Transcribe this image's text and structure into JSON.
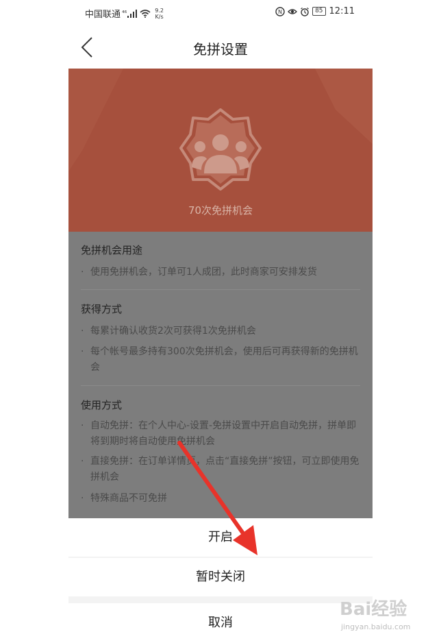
{
  "status_bar": {
    "carrier": "中国联通",
    "network_badge": "⁴⁶",
    "net_speed_value": "9.2",
    "net_speed_unit": "K/s",
    "battery": "85",
    "time": "12:11"
  },
  "nav": {
    "title": "免拼设置"
  },
  "hero": {
    "text": "70次免拼机会"
  },
  "sections": [
    {
      "title": "免拼机会用途",
      "items": [
        "使用免拼机会，订单可1人成团，此时商家可安排发货"
      ]
    },
    {
      "title": "获得方式",
      "items": [
        "每累计确认收货2次可获得1次免拼机会",
        "每个帐号最多持有300次免拼机会，使用后可再获得新的免拼机会"
      ]
    },
    {
      "title": "使用方式",
      "items": [
        "自动免拼：在个人中心-设置-免拼设置中开启自动免拼，拼单即将到期时将自动使用免拼机会",
        "直接免拼：在订单详情页，点击“直接免拼”按钮，可立即使用免拼机会",
        "特殊商品不可免拼"
      ]
    }
  ],
  "sheet": {
    "enable_label": "开启",
    "pause_label": "暂时关闭",
    "cancel_label": "取消"
  },
  "watermark": {
    "logo": "Bai经验",
    "sub": "jingyan.baidu.com"
  },
  "colors": {
    "hero_bg": "#a6503d",
    "overlay_content": "#7d7d7d",
    "arrow": "#e8332a"
  }
}
